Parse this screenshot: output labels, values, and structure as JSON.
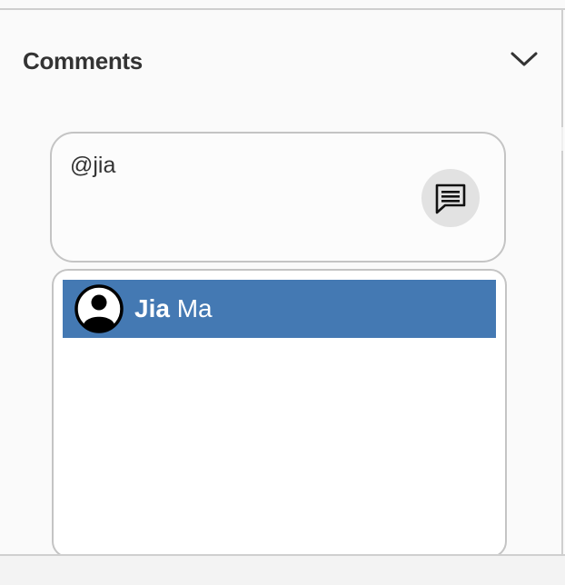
{
  "comments_panel": {
    "title": "Comments",
    "collapse_icon": "chevron-down-icon",
    "input_value": "@jia",
    "send_icon": "comment-icon"
  },
  "mention_suggestions": {
    "items": [
      {
        "match": "Jia",
        "rest": " Ma",
        "avatar_icon": "user-avatar-icon",
        "selected": true
      }
    ],
    "highlight_color": "#4479b3"
  }
}
